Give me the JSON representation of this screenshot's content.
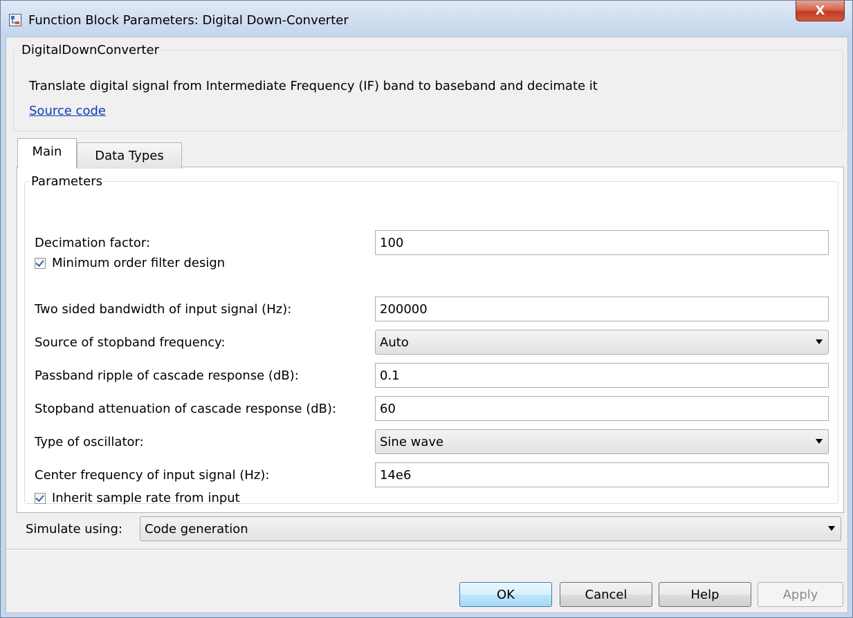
{
  "window": {
    "title": "Function Block Parameters: Digital Down-Converter",
    "close_label": "X"
  },
  "description": {
    "group_title": "DigitalDownConverter",
    "text": "Translate digital signal from Intermediate Frequency (IF) band to baseband and decimate it",
    "link": "Source code"
  },
  "tabs": [
    {
      "label": "Main",
      "selected": true
    },
    {
      "label": "Data Types",
      "selected": false
    }
  ],
  "parameters": {
    "group_title": "Parameters",
    "decimation_factor": {
      "label": "Decimation factor:",
      "value": "100"
    },
    "min_order": {
      "label": "Minimum order filter design",
      "checked": true
    },
    "bandwidth": {
      "label": "Two sided bandwidth of input signal (Hz):",
      "value": "200000"
    },
    "stopband_source": {
      "label": "Source of stopband frequency:",
      "value": "Auto"
    },
    "passband_ripple": {
      "label": "Passband ripple of cascade response (dB):",
      "value": "0.1"
    },
    "stopband_atten": {
      "label": "Stopband attenuation of cascade response (dB):",
      "value": "60"
    },
    "oscillator": {
      "label": "Type of oscillator:",
      "value": "Sine wave"
    },
    "center_freq": {
      "label": "Center frequency of input signal (Hz):",
      "value": "14e6"
    },
    "inherit_rate": {
      "label": "Inherit sample rate from input",
      "checked": true
    }
  },
  "simulate": {
    "label": "Simulate using:",
    "value": "Code generation"
  },
  "buttons": {
    "ok": "OK",
    "cancel": "Cancel",
    "help": "Help",
    "apply": "Apply"
  },
  "colors": {
    "link": "#0b3bb8",
    "close": "#c23b22",
    "check": "#3a5eaa"
  }
}
